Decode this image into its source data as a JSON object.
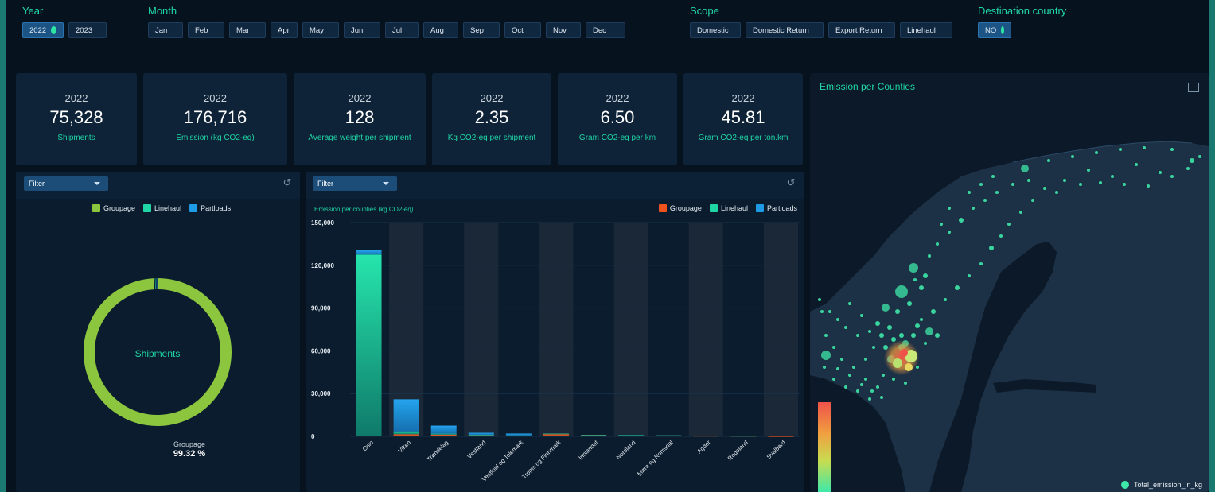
{
  "filters": {
    "year": {
      "title": "Year",
      "options": [
        "2022",
        "2023"
      ]
    },
    "month": {
      "title": "Month",
      "options": [
        "Jan",
        "Feb",
        "Mar",
        "Apr",
        "May",
        "Jun",
        "Jul",
        "Aug",
        "Sep",
        "Oct",
        "Nov",
        "Dec"
      ]
    },
    "scope": {
      "title": "Scope",
      "options": [
        "Domestic",
        "Domestic Return",
        "Export Return",
        "Linehaul"
      ]
    },
    "destination": {
      "title": "Destination country",
      "options": [
        "NO"
      ]
    }
  },
  "kpis": [
    {
      "year": "2022",
      "value": "75,328",
      "label": "Shipments"
    },
    {
      "year": "2022",
      "value": "176,716",
      "label": "Emission (kg CO2-eq)"
    },
    {
      "year": "2022",
      "value": "128",
      "label": "Average weight per shipment"
    },
    {
      "year": "2022",
      "value": "2.35",
      "label": "Kg CO2-eq per shipment"
    },
    {
      "year": "2022",
      "value": "6.50",
      "label": "Gram CO2-eq per km"
    },
    {
      "year": "2022",
      "value": "45.81",
      "label": "Gram CO2-eq per ton.km"
    }
  ],
  "donut_panel": {
    "filter_label": "Filter",
    "legend": [
      {
        "name": "Groupage",
        "color": "#8cc63f"
      },
      {
        "name": "Linehaul",
        "color": "#1fd7a5"
      },
      {
        "name": "Partloads",
        "color": "#1e9be6"
      }
    ],
    "center_label": "Shipments",
    "slice_label": "Groupage",
    "slice_percent": "99.32 %",
    "slices": [
      {
        "name": "Groupage",
        "share": 99.32,
        "color": "#8cc63f"
      },
      {
        "name": "Linehaul",
        "share": 0.34,
        "color": "#1fd7a5"
      },
      {
        "name": "Partloads",
        "share": 0.34,
        "color": "#1e9be6"
      }
    ]
  },
  "bar_panel": {
    "filter_label": "Filter",
    "legend": [
      {
        "name": "Groupage",
        "color": "#f0521e"
      },
      {
        "name": "Linehaul",
        "color": "#1fd7a5"
      },
      {
        "name": "Partloads",
        "color": "#1e9be6"
      }
    ]
  },
  "chart_data": {
    "type": "bar",
    "title": "Emission per counties (kg CO2-eq)",
    "stacked": true,
    "ylim": [
      0,
      150000
    ],
    "yticks": [
      "0",
      "30,000",
      "60,000",
      "90,000",
      "120,000",
      "150,000"
    ],
    "categories": [
      "Oslo",
      "Viken",
      "Trøndelag",
      "Vestland",
      "Vestfold og Telemark",
      "Troms og Finnmark",
      "Innlandet",
      "Nordland",
      "Møre og Romsdal",
      "Agder",
      "Rogaland",
      "Svalbard"
    ],
    "series": [
      {
        "name": "Groupage",
        "color": "#f0521e",
        "values": [
          0,
          1500,
          1200,
          800,
          500,
          1800,
          900,
          700,
          600,
          300,
          200,
          50
        ]
      },
      {
        "name": "Linehaul",
        "color": "#1fd7a5",
        "values": [
          127500,
          2000,
          700,
          300,
          200,
          100,
          200,
          200,
          100,
          100,
          50,
          0
        ]
      },
      {
        "name": "Partloads",
        "color": "#1e9be6",
        "values": [
          3000,
          22500,
          5600,
          1400,
          1300,
          0,
          0,
          0,
          0,
          0,
          0,
          0
        ]
      }
    ]
  },
  "map_panel": {
    "title": "Emission per Counties",
    "legend_label": "Total_emission_in_kg",
    "color_scale": [
      "#f0524a",
      "#f0a040",
      "#c8dc50",
      "#3ee8a8"
    ]
  }
}
